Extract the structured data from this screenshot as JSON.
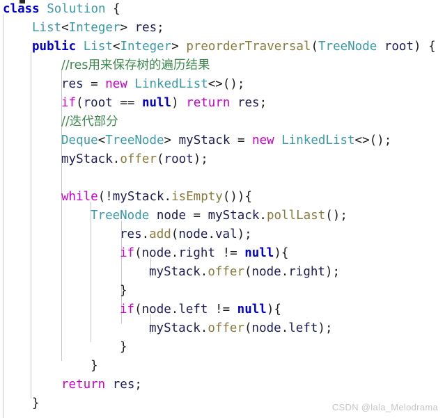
{
  "editor": {
    "language": "java",
    "background_color": "#ffffff",
    "indent_guide_color": "#c8c8c8",
    "line_height_px": 27,
    "font_size_px": 17.5,
    "indent_guide_x": [
      4,
      44,
      88,
      130,
      174
    ],
    "colors": {
      "keyword_magenta": "#cc00cc",
      "keyword_blue": "#0000d0",
      "type_teal": "#3a9aa8",
      "method_olive": "#8a7a3c",
      "identifier_navy": "#1c1c5a",
      "comment_green": "#3f8a4f",
      "plain_text": "#1c1c1c",
      "watermark_gray": "#c6c6c6"
    }
  },
  "code": {
    "lines": [
      {
        "n": 1,
        "indent": 0,
        "text": "class Solution {"
      },
      {
        "n": 2,
        "indent": 1,
        "text": "List<Integer> res;"
      },
      {
        "n": 3,
        "indent": 1,
        "text": "public List<Integer> preorderTraversal(TreeNode root) {"
      },
      {
        "n": 4,
        "indent": 2,
        "text": "//res用来保存树的遍历结果"
      },
      {
        "n": 5,
        "indent": 2,
        "text": "res = new LinkedList<>();"
      },
      {
        "n": 6,
        "indent": 2,
        "text": "if(root == null) return res;"
      },
      {
        "n": 7,
        "indent": 2,
        "text": "//迭代部分"
      },
      {
        "n": 8,
        "indent": 2,
        "text": "Deque<TreeNode> myStack = new LinkedList<>();"
      },
      {
        "n": 9,
        "indent": 2,
        "text": "myStack.offer(root);"
      },
      {
        "n": 10,
        "indent": 2,
        "text": ""
      },
      {
        "n": 11,
        "indent": 2,
        "text": "while(!myStack.isEmpty()){"
      },
      {
        "n": 12,
        "indent": 3,
        "text": "TreeNode node = myStack.pollLast();"
      },
      {
        "n": 13,
        "indent": 4,
        "text": "res.add(node.val);"
      },
      {
        "n": 14,
        "indent": 4,
        "text": "if(node.right != null){"
      },
      {
        "n": 15,
        "indent": 5,
        "text": "myStack.offer(node.right);"
      },
      {
        "n": 16,
        "indent": 4,
        "text": "}"
      },
      {
        "n": 17,
        "indent": 4,
        "text": "if(node.left != null){"
      },
      {
        "n": 18,
        "indent": 5,
        "text": "myStack.offer(node.left);"
      },
      {
        "n": 19,
        "indent": 4,
        "text": "}"
      },
      {
        "n": 20,
        "indent": 3,
        "text": "}"
      },
      {
        "n": 21,
        "indent": 2,
        "text": "return res;"
      },
      {
        "n": 22,
        "indent": 1,
        "text": "}"
      }
    ]
  },
  "watermark": {
    "text": "CSDN @lala_Melodrama"
  }
}
